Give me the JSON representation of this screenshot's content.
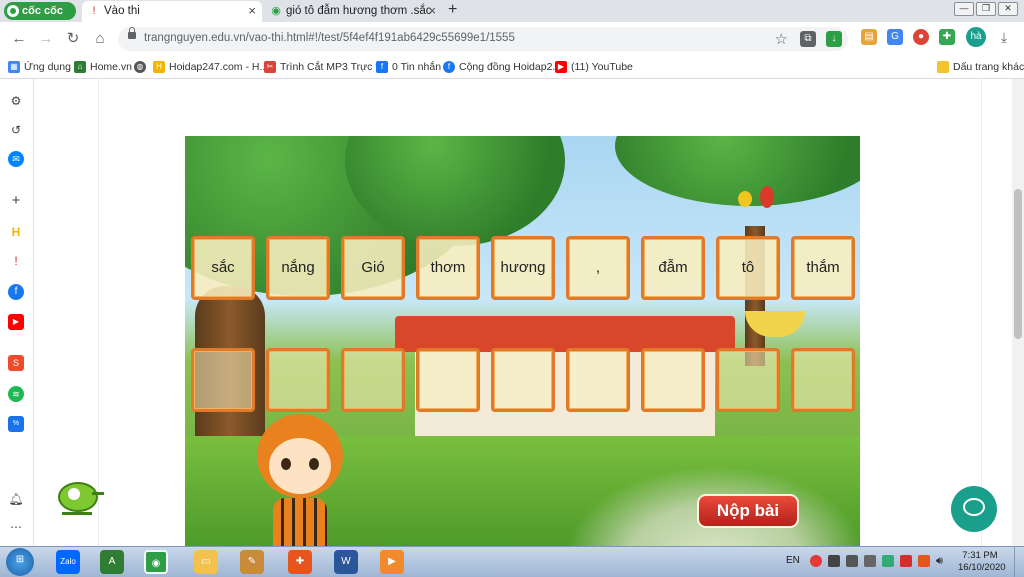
{
  "browser": {
    "brand": "cốc cốc",
    "tabs": [
      {
        "title": "Vào thi",
        "active": true
      },
      {
        "title": "gió tô đẫm hương thơm .sắc",
        "active": false
      }
    ],
    "new_tab": "+",
    "url": "trangnguyen.edu.vn/vao-thi.html#!/test/5f4ef4f191ab6429c55699e1/1555",
    "profile_initials": "hà",
    "window_controls": [
      "—",
      "❐",
      "✕"
    ]
  },
  "bookmarks": {
    "items": [
      {
        "label": "Ứng dụng",
        "icon": "apps-grid-icon",
        "color": "#4285f4"
      },
      {
        "label": "Home.vn",
        "icon": "home-icon",
        "color": "#2e7d32"
      },
      {
        "label": "Hoidap247.com - H...",
        "icon": "hoidap-icon",
        "color": "#f4b400"
      },
      {
        "label": "Trình Cắt MP3 Trực t...",
        "icon": "scissors-icon",
        "color": "#db4437"
      },
      {
        "label": "0 Tin nhắn",
        "icon": "facebook-icon",
        "color": "#1877f2"
      },
      {
        "label": "Cộng đồng Hoidap2...",
        "icon": "facebook-icon",
        "color": "#1877f2"
      },
      {
        "label": "(11) YouTube",
        "icon": "youtube-icon",
        "color": "#ff0000"
      }
    ],
    "other": "Dấu trang khác"
  },
  "game": {
    "word_cards": [
      "sắc",
      "nắng",
      "Gió",
      "thơm",
      "hương",
      ",",
      "đẫm",
      "tô",
      "thắm"
    ],
    "answer_slots": 9,
    "submit_label": "Nộp bài"
  },
  "taskbar": {
    "language": "EN",
    "time": "7:31 PM",
    "date": "16/10/2020"
  },
  "colors": {
    "card_border": "#e07a2a",
    "submit": "#d0362a",
    "chat": "#1b9f8d"
  }
}
